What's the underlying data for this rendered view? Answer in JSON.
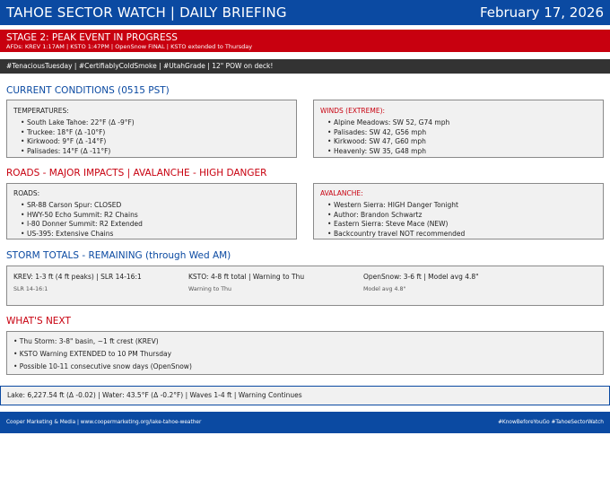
{
  "header": {
    "title": "TAHOE SECTOR WATCH | DAILY BRIEFING",
    "date": "February 17, 2026"
  },
  "stage": {
    "title": "STAGE 2: PEAK EVENT IN PROGRESS",
    "afds": "AFDs: KREV 1:17AM | KSTO 1:47PM | OpenSnow FINAL | KSTO extended to Thursday"
  },
  "tags": "#TenaciousTuesday | #CertifiablyColdSmoke | #UtahGrade | 12\" POW on deck!",
  "conditions": {
    "heading": "CURRENT CONDITIONS (0515 PST)",
    "temps_label": "TEMPERATURES:",
    "temps": [
      "South Lake Tahoe: 22°F (Δ -9°F)",
      "Truckee: 18°F (Δ -10°F)",
      "Kirkwood: 9°F (Δ -14°F)",
      "Palisades: 14°F (Δ -11°F)"
    ],
    "winds_label": "WINDS (EXTREME):",
    "winds": [
      "Alpine Meadows: SW 52, G74 mph",
      "Palisades: SW 42, G56 mph",
      "Kirkwood: SW 47, G60 mph",
      "Heavenly: SW 35, G48 mph"
    ]
  },
  "roads": {
    "heading": "ROADS - MAJOR IMPACTS | AVALANCHE - HIGH DANGER",
    "roads_label": "ROADS:",
    "roads": [
      "SR-88 Carson Spur: CLOSED",
      "HWY-50 Echo Summit: R2 Chains",
      "I-80 Donner Summit: R2 Extended",
      "US-395: Extensive Chains"
    ],
    "aval_label": "AVALANCHE:",
    "aval": [
      "Western Sierra: HIGH Danger Tonight",
      "Author: Brandon Schwartz",
      "Eastern Sierra: Steve Mace (NEW)",
      "Backcountry travel NOT recommended"
    ]
  },
  "storm": {
    "heading": "STORM TOTALS - REMAINING (through Wed AM)",
    "cols": [
      {
        "main": "KREV: 1-3 ft (4 ft peaks) | SLR 14-16:1",
        "sub": "SLR 14-16:1"
      },
      {
        "main": "KSTO: 4-8 ft total | Warning to Thu",
        "sub": "Warning to Thu"
      },
      {
        "main": "OpenSnow: 3-6 ft | Model avg 4.8\"",
        "sub": "Model avg 4.8\""
      }
    ]
  },
  "next": {
    "heading": "WHAT'S NEXT",
    "items": [
      "• Thu Storm: 3-8\" basin, ~1 ft crest (KREV)",
      "• KSTO Warning EXTENDED to 10 PM Thursday",
      "• Possible 10-11 consecutive snow days (OpenSnow)"
    ]
  },
  "lake": "Lake: 6,227.54 ft (Δ -0.02) | Water: 43.5°F (Δ -0.2°F) | Waves 1-4 ft | Warning Continues",
  "footer": {
    "left": "Cooper Marketing & Media | www.coopermarketing.org/lake-tahoe-weather",
    "right": "#KnowBeforeYouGo #TahoeSectorWatch"
  }
}
